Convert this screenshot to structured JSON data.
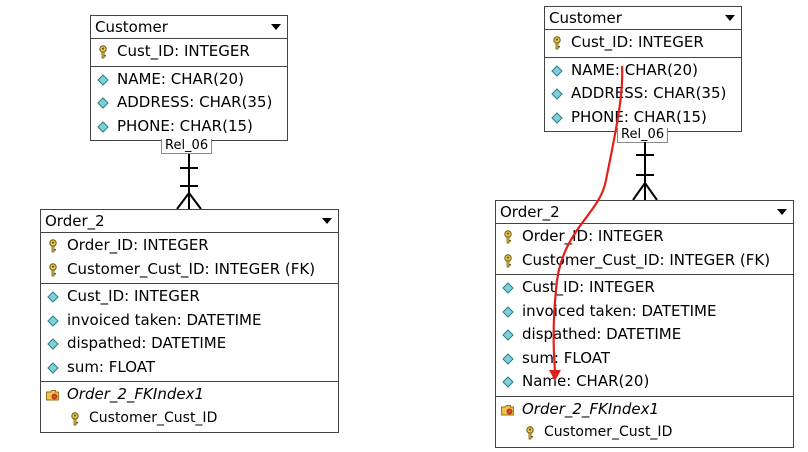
{
  "left": {
    "customer": {
      "name": "Customer",
      "keys": [
        {
          "label": "Cust_ID: INTEGER",
          "icon": "key-icon"
        }
      ],
      "attrs": [
        {
          "label": "NAME: CHAR(20)",
          "icon": "diamond-icon"
        },
        {
          "label": "ADDRESS: CHAR(35)",
          "icon": "diamond-icon"
        },
        {
          "label": "PHONE: CHAR(15)",
          "icon": "diamond-icon"
        }
      ]
    },
    "relationship": "Rel_06",
    "order": {
      "name": "Order_2",
      "keys": [
        {
          "label": "Order_ID: INTEGER",
          "icon": "key-icon"
        },
        {
          "label": "Customer_Cust_ID: INTEGER (FK)",
          "icon": "key-icon"
        }
      ],
      "attrs": [
        {
          "label": "Cust_ID: INTEGER",
          "icon": "diamond-icon"
        },
        {
          "label": "invoiced taken: DATETIME",
          "icon": "diamond-icon"
        },
        {
          "label": "dispathed: DATETIME",
          "icon": "diamond-icon"
        },
        {
          "label": "sum: FLOAT",
          "icon": "diamond-icon"
        }
      ],
      "index": {
        "label": "Order_2_FKIndex1",
        "icon": "folder-icon"
      },
      "index_member": {
        "label": "Customer_Cust_ID",
        "icon": "key-icon"
      }
    }
  },
  "right": {
    "customer": {
      "name": "Customer",
      "keys": [
        {
          "label": "Cust_ID: INTEGER",
          "icon": "key-icon"
        }
      ],
      "attrs": [
        {
          "label": "NAME: CHAR(20)",
          "icon": "diamond-icon"
        },
        {
          "label": "ADDRESS: CHAR(35)",
          "icon": "diamond-icon"
        },
        {
          "label": "PHONE: CHAR(15)",
          "icon": "diamond-icon"
        }
      ]
    },
    "relationship": "Rel_06",
    "order": {
      "name": "Order_2",
      "keys": [
        {
          "label": "Order_ID: INTEGER",
          "icon": "key-icon"
        },
        {
          "label": "Customer_Cust_ID: INTEGER (FK)",
          "icon": "key-icon"
        }
      ],
      "attrs": [
        {
          "label": "Cust_ID: INTEGER",
          "icon": "diamond-icon"
        },
        {
          "label": "invoiced taken: DATETIME",
          "icon": "diamond-icon"
        },
        {
          "label": "dispathed: DATETIME",
          "icon": "diamond-icon"
        },
        {
          "label": "sum: FLOAT",
          "icon": "diamond-icon"
        },
        {
          "label": "Name: CHAR(20)",
          "icon": "diamond-icon"
        }
      ],
      "index": {
        "label": "Order_2_FKIndex1",
        "icon": "folder-icon"
      },
      "index_member": {
        "label": "Customer_Cust_ID",
        "icon": "key-icon"
      }
    },
    "arrow_color": "#e0201a"
  }
}
